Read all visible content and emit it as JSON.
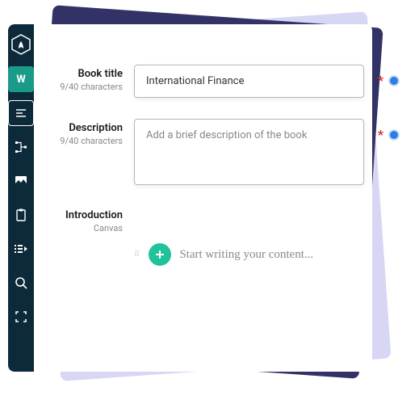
{
  "fields": {
    "book_title": {
      "label": "Book title",
      "counter": "9/40 characters",
      "value": "International Finance"
    },
    "description": {
      "label": "Description",
      "counter": "9/40 characters",
      "placeholder": "Add a brief description of the book"
    },
    "introduction": {
      "label": "Introduction",
      "sub": "Canvas",
      "placeholder": "Start writing your content..."
    }
  },
  "sidebar": {
    "items": [
      {
        "name": "logo-icon"
      },
      {
        "name": "write-icon",
        "badge": "W"
      },
      {
        "name": "text-align-icon"
      },
      {
        "name": "structure-icon"
      },
      {
        "name": "image-icon"
      },
      {
        "name": "clipboard-icon"
      },
      {
        "name": "list-expand-icon"
      },
      {
        "name": "search-icon"
      },
      {
        "name": "fullscreen-icon"
      }
    ]
  },
  "colors": {
    "sidebar_bg": "#0d2a3a",
    "accent_teal": "#1a9b8a",
    "add_button": "#1fc29b",
    "required": "#d92d2d",
    "info_dot": "#2f7de1"
  }
}
